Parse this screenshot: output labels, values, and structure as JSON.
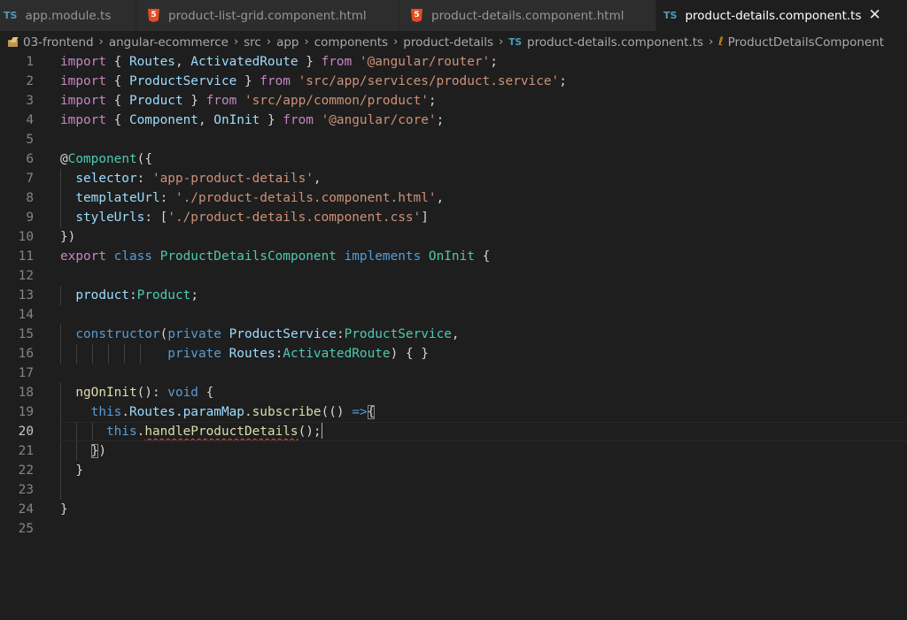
{
  "tabs": [
    {
      "label": "app.module.ts",
      "icon": "typescript-icon",
      "icon_text": "TS"
    },
    {
      "label": "product-list-grid.component.html",
      "icon": "html5-icon",
      "icon_text": "5"
    },
    {
      "label": "product-details.component.html",
      "icon": "html5-icon",
      "icon_text": "5"
    },
    {
      "label": "product-details.component.ts",
      "icon": "typescript-icon",
      "icon_text": "TS",
      "active": true
    }
  ],
  "close_glyph": "✕",
  "breadcrumb": {
    "items": [
      "03-frontend",
      "angular-ecommerce",
      "src",
      "app",
      "components",
      "product-details",
      "product-details.component.ts",
      "ProductDetailsComponent"
    ],
    "separator": "›",
    "ts_icon_text": "TS",
    "symbol_glyph": "ℓ"
  },
  "colors": {
    "editor_bg": "#1e1e1e",
    "keyword": "#c586c0",
    "storage": "#569cd6",
    "string": "#ce9178",
    "type": "#4ec9b0",
    "variable": "#9cdcfe",
    "function": "#dcdcaa",
    "error_squiggle": "#f14c4c"
  },
  "editor": {
    "current_line": 20,
    "lines": [
      {
        "n": "1",
        "t": [
          {
            "c": "kw",
            "v": "import"
          },
          {
            "c": "pl",
            "v": " { "
          },
          {
            "c": "var",
            "v": "Routes"
          },
          {
            "c": "pl",
            "v": ", "
          },
          {
            "c": "var",
            "v": "ActivatedRoute"
          },
          {
            "c": "pl",
            "v": " } "
          },
          {
            "c": "kw",
            "v": "from"
          },
          {
            "c": "pl",
            "v": " "
          },
          {
            "c": "str",
            "v": "'@angular/router'"
          },
          {
            "c": "pl",
            "v": ";"
          }
        ]
      },
      {
        "n": "2",
        "t": [
          {
            "c": "kw",
            "v": "import"
          },
          {
            "c": "pl",
            "v": " { "
          },
          {
            "c": "var",
            "v": "ProductService"
          },
          {
            "c": "pl",
            "v": " } "
          },
          {
            "c": "kw",
            "v": "from"
          },
          {
            "c": "pl",
            "v": " "
          },
          {
            "c": "str",
            "v": "'src/app/services/product.service'"
          },
          {
            "c": "pl",
            "v": ";"
          }
        ]
      },
      {
        "n": "3",
        "t": [
          {
            "c": "kw",
            "v": "import"
          },
          {
            "c": "pl",
            "v": " { "
          },
          {
            "c": "var",
            "v": "Product"
          },
          {
            "c": "pl",
            "v": " } "
          },
          {
            "c": "kw",
            "v": "from"
          },
          {
            "c": "pl",
            "v": " "
          },
          {
            "c": "str",
            "v": "'src/app/common/product'"
          },
          {
            "c": "pl",
            "v": ";"
          }
        ]
      },
      {
        "n": "4",
        "t": [
          {
            "c": "kw",
            "v": "import"
          },
          {
            "c": "pl",
            "v": " { "
          },
          {
            "c": "var",
            "v": "Component"
          },
          {
            "c": "pl",
            "v": ", "
          },
          {
            "c": "var",
            "v": "OnInit"
          },
          {
            "c": "pl",
            "v": " } "
          },
          {
            "c": "kw",
            "v": "from"
          },
          {
            "c": "pl",
            "v": " "
          },
          {
            "c": "str",
            "v": "'@angular/core'"
          },
          {
            "c": "pl",
            "v": ";"
          }
        ]
      },
      {
        "n": "5",
        "t": []
      },
      {
        "n": "6",
        "t": [
          {
            "c": "pl",
            "v": "@"
          },
          {
            "c": "ty",
            "v": "Component"
          },
          {
            "c": "pl",
            "v": "({"
          }
        ]
      },
      {
        "n": "7",
        "t": [
          {
            "c": "pl",
            "v": "  "
          },
          {
            "c": "var",
            "v": "selector"
          },
          {
            "c": "pl",
            "v": ": "
          },
          {
            "c": "str",
            "v": "'app-product-details'"
          },
          {
            "c": "pl",
            "v": ","
          }
        ]
      },
      {
        "n": "8",
        "t": [
          {
            "c": "pl",
            "v": "  "
          },
          {
            "c": "var",
            "v": "templateUrl"
          },
          {
            "c": "pl",
            "v": ": "
          },
          {
            "c": "str",
            "v": "'./product-details.component.html'"
          },
          {
            "c": "pl",
            "v": ","
          }
        ]
      },
      {
        "n": "9",
        "t": [
          {
            "c": "pl",
            "v": "  "
          },
          {
            "c": "var",
            "v": "styleUrls"
          },
          {
            "c": "pl",
            "v": ": ["
          },
          {
            "c": "str",
            "v": "'./product-details.component.css'"
          },
          {
            "c": "pl",
            "v": "]"
          }
        ]
      },
      {
        "n": "10",
        "t": [
          {
            "c": "pl",
            "v": "})"
          }
        ]
      },
      {
        "n": "11",
        "t": [
          {
            "c": "kw",
            "v": "export"
          },
          {
            "c": "pl",
            "v": " "
          },
          {
            "c": "kw2",
            "v": "class"
          },
          {
            "c": "pl",
            "v": " "
          },
          {
            "c": "ty",
            "v": "ProductDetailsComponent"
          },
          {
            "c": "pl",
            "v": " "
          },
          {
            "c": "kw2",
            "v": "implements"
          },
          {
            "c": "pl",
            "v": " "
          },
          {
            "c": "ty",
            "v": "OnInit"
          },
          {
            "c": "pl",
            "v": " {"
          }
        ]
      },
      {
        "n": "12",
        "t": []
      },
      {
        "n": "13",
        "t": [
          {
            "c": "pl",
            "v": "  "
          },
          {
            "c": "var",
            "v": "product"
          },
          {
            "c": "pl",
            "v": ":"
          },
          {
            "c": "ty",
            "v": "Product"
          },
          {
            "c": "pl",
            "v": ";"
          }
        ]
      },
      {
        "n": "14",
        "t": []
      },
      {
        "n": "15",
        "t": [
          {
            "c": "pl",
            "v": "  "
          },
          {
            "c": "kw2",
            "v": "constructor"
          },
          {
            "c": "pl",
            "v": "("
          },
          {
            "c": "kw2",
            "v": "private"
          },
          {
            "c": "pl",
            "v": " "
          },
          {
            "c": "var",
            "v": "ProductService"
          },
          {
            "c": "pl",
            "v": ":"
          },
          {
            "c": "ty",
            "v": "ProductService"
          },
          {
            "c": "pl",
            "v": ","
          }
        ]
      },
      {
        "n": "16",
        "t": [
          {
            "c": "pl",
            "v": "              "
          },
          {
            "c": "kw2",
            "v": "private"
          },
          {
            "c": "pl",
            "v": " "
          },
          {
            "c": "var",
            "v": "Routes"
          },
          {
            "c": "pl",
            "v": ":"
          },
          {
            "c": "ty",
            "v": "ActivatedRoute"
          },
          {
            "c": "pl",
            "v": ") { }"
          }
        ]
      },
      {
        "n": "17",
        "t": []
      },
      {
        "n": "18",
        "t": [
          {
            "c": "pl",
            "v": "  "
          },
          {
            "c": "fn",
            "v": "ngOnInit"
          },
          {
            "c": "pl",
            "v": "(): "
          },
          {
            "c": "kw2",
            "v": "void"
          },
          {
            "c": "pl",
            "v": " {"
          }
        ]
      },
      {
        "n": "19",
        "t": [
          {
            "c": "pl",
            "v": "    "
          },
          {
            "c": "kw2",
            "v": "this"
          },
          {
            "c": "pl",
            "v": "."
          },
          {
            "c": "var",
            "v": "Routes"
          },
          {
            "c": "pl",
            "v": "."
          },
          {
            "c": "var",
            "v": "paramMap"
          },
          {
            "c": "pl",
            "v": "."
          },
          {
            "c": "fn",
            "v": "subscribe"
          },
          {
            "c": "pl",
            "v": "(() "
          },
          {
            "c": "kw2",
            "v": "=>"
          },
          {
            "c": "pl bm",
            "v": "{"
          }
        ]
      },
      {
        "n": "20",
        "t": [
          {
            "c": "pl",
            "v": "      "
          },
          {
            "c": "kw2",
            "v": "this"
          },
          {
            "c": "pl",
            "v": "."
          },
          {
            "c": "fn squig",
            "v": "handleProductDetails"
          },
          {
            "c": "pl",
            "v": "();"
          },
          {
            "c": "cursor",
            "v": ""
          }
        ]
      },
      {
        "n": "21",
        "t": [
          {
            "c": "pl",
            "v": "    "
          },
          {
            "c": "pl bm",
            "v": "}"
          },
          {
            "c": "pl",
            "v": ")"
          }
        ]
      },
      {
        "n": "22",
        "t": [
          {
            "c": "pl",
            "v": "  }"
          }
        ]
      },
      {
        "n": "23",
        "t": []
      },
      {
        "n": "24",
        "t": [
          {
            "c": "pl",
            "v": "}"
          }
        ]
      },
      {
        "n": "25",
        "t": []
      }
    ]
  }
}
